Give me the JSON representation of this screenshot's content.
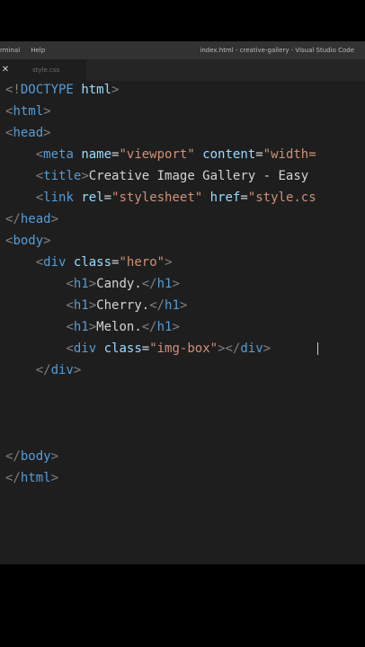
{
  "titlebar": {
    "menu": [
      "rminal",
      "Help"
    ],
    "window_title": "index.html - creative-gallery - Visual Studio Code"
  },
  "tab": {
    "close_glyph": "✕",
    "label": "style.css"
  },
  "code": {
    "l1": {
      "a": "<!",
      "b": "DOCTYPE",
      "c": " ",
      "d": "html",
      "e": ">"
    },
    "l2": {
      "a": "<",
      "b": "html",
      "c": ">"
    },
    "l3": {
      "a": "<",
      "b": "head",
      "c": ">"
    },
    "l4": {
      "indent": "    ",
      "a": "<",
      "b": "meta",
      "c": " ",
      "d": "name",
      "e": "=",
      "f": "\"viewport\"",
      "g": " ",
      "h": "content",
      "i": "=",
      "j": "\"width="
    },
    "l5": {
      "indent": "    ",
      "a": "<",
      "b": "title",
      "c": ">",
      "d": "Creative Image Gallery - Easy"
    },
    "l6": {
      "indent": "    ",
      "a": "<",
      "b": "link",
      "c": " ",
      "d": "rel",
      "e": "=",
      "f": "\"stylesheet\"",
      "g": " ",
      "h": "href",
      "i": "=",
      "j": "\"style.cs"
    },
    "l7": {
      "a": "</",
      "b": "head",
      "c": ">"
    },
    "l8": {
      "a": "<",
      "b": "body",
      "c": ">"
    },
    "l9": {
      "indent": "    ",
      "a": "<",
      "b": "div",
      "c": " ",
      "d": "class",
      "e": "=",
      "f": "\"hero\"",
      "g": ">"
    },
    "l10": {
      "indent": "        ",
      "a": "<",
      "b": "h1",
      "c": ">",
      "d": "Candy.",
      "e": "</",
      "f": "h1",
      "g": ">"
    },
    "l11": {
      "indent": "        ",
      "a": "<",
      "b": "h1",
      "c": ">",
      "d": "Cherry.",
      "e": "</",
      "f": "h1",
      "g": ">"
    },
    "l12": {
      "indent": "        ",
      "a": "<",
      "b": "h1",
      "c": ">",
      "d": "Melon.",
      "e": "</",
      "f": "h1",
      "g": ">"
    },
    "l13": {
      "indent": "        ",
      "a": "<",
      "b": "div",
      "c": " ",
      "d": "class",
      "e": "=",
      "f": "\"img-box\"",
      "g": ">",
      "h": "</",
      "i": "div",
      "j": ">"
    },
    "l14": {
      "indent": "    ",
      "a": "</",
      "b": "div",
      "c": ">"
    },
    "l15": {
      "a": "</",
      "b": "body",
      "c": ">"
    },
    "l16": {
      "a": "</",
      "b": "html",
      "c": ">"
    }
  }
}
